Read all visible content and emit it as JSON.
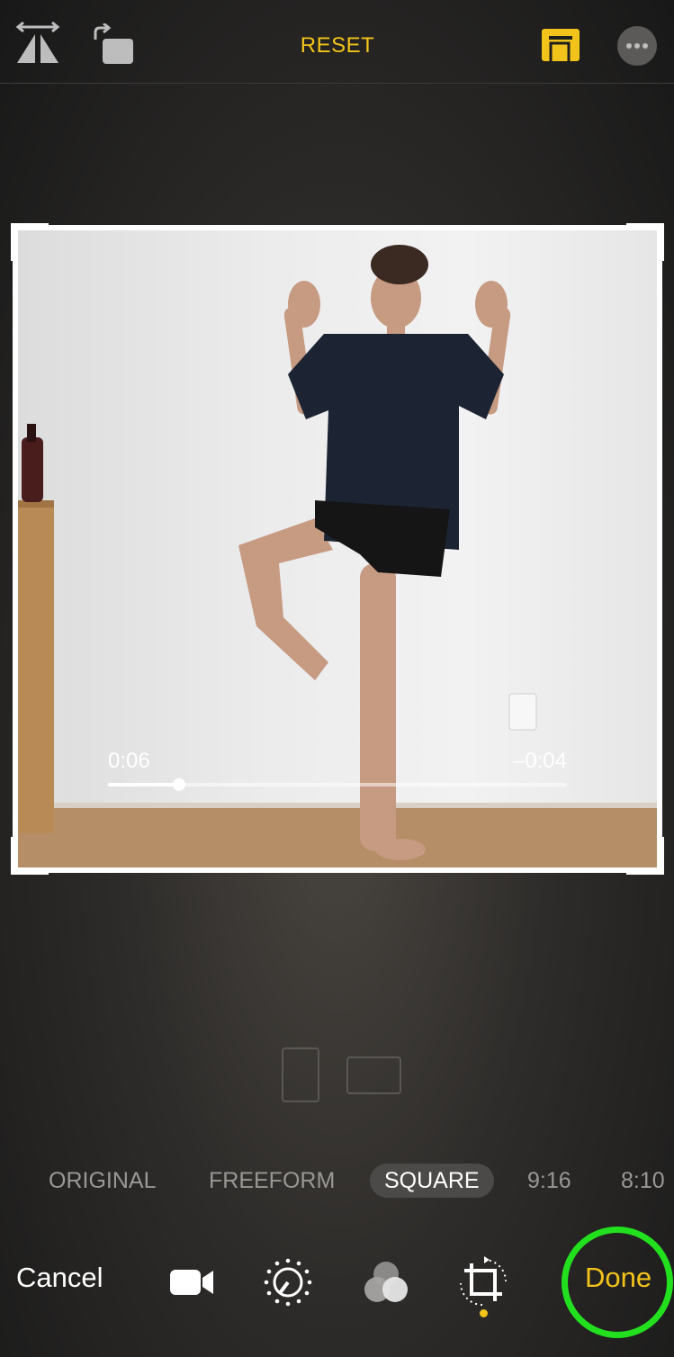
{
  "top_bar": {
    "flip_icon": "flip-horizontal-icon",
    "rotate_icon": "rotate-icon",
    "reset_label": "RESET",
    "aspect_icon": "aspect-ratio-icon",
    "more_icon": "more-options-icon"
  },
  "video": {
    "elapsed": "0:06",
    "remaining": "–0:04",
    "progress": 0.155
  },
  "orientation": {
    "portrait_icon": "portrait-orientation-icon",
    "landscape_icon": "landscape-orientation-icon"
  },
  "aspect_ratios": {
    "items": [
      "ORIGINAL",
      "FREEFORM",
      "SQUARE",
      "9:16",
      "8:10"
    ],
    "selected": "SQUARE"
  },
  "toolbar": {
    "cancel_label": "Cancel",
    "done_label": "Done",
    "tools": [
      "video-camera-icon",
      "adjust-dial-icon",
      "filters-icon",
      "crop-rotate-icon"
    ]
  },
  "colors": {
    "accent": "#f2c31a",
    "highlight": "#22e01e"
  }
}
